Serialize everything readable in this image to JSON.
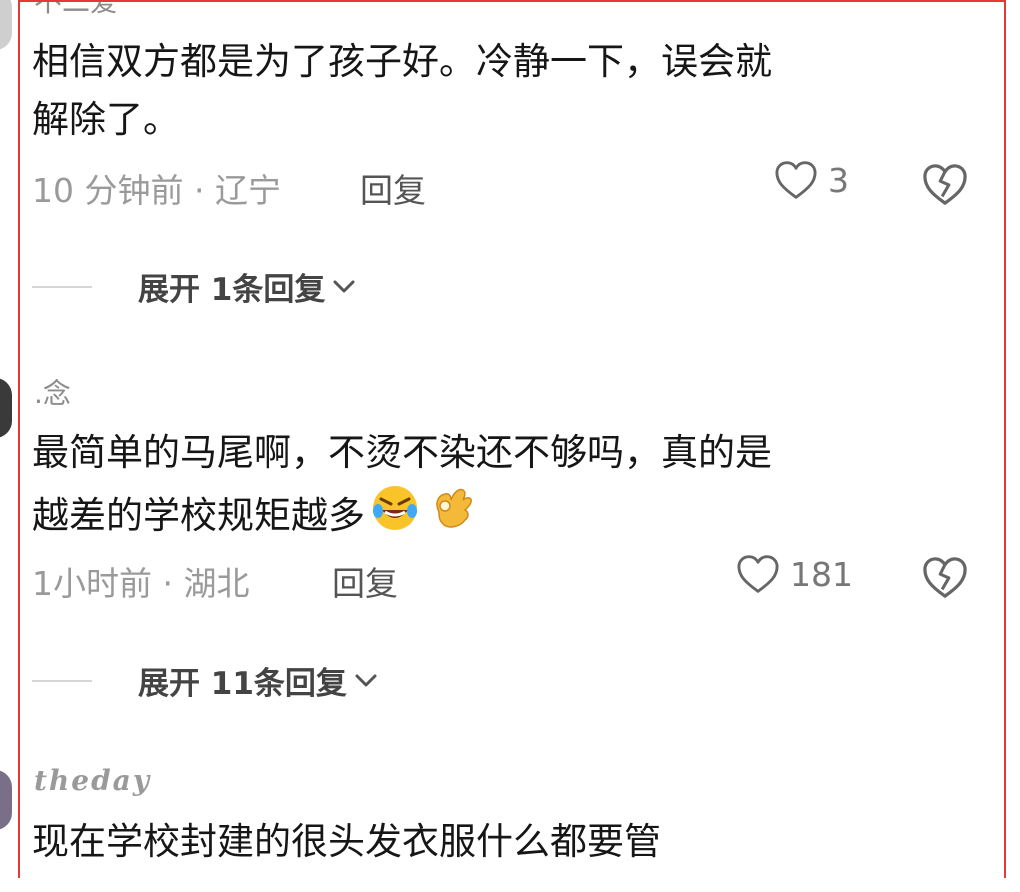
{
  "comments": [
    {
      "username": "不二爱",
      "content_line1": "相信双方都是为了孩子好。冷静一下，误会就",
      "content_line2": "解除了。",
      "meta": "10 分钟前 · 辽宁",
      "reply_label": "回复",
      "likes": "3",
      "expand_label": "展开 1条回复"
    },
    {
      "username": ".念",
      "content_line1": "最简单的马尾啊，不烫不染还不够吗，真的是",
      "content_line2": "越差的学校规矩越多",
      "meta": "1小时前 · 湖北",
      "reply_label": "回复",
      "likes": "181",
      "expand_label": "展开 11条回复"
    },
    {
      "username": "theday",
      "content_line1": "现在学校封建的很头发衣服什么都要管"
    }
  ],
  "icons": {
    "like": "heart-outline-icon",
    "dislike": "broken-heart-icon",
    "expand": "chevron-down-icon",
    "emoji1": "rofl-emoji",
    "emoji2": "ok-hand-emoji"
  },
  "colors": {
    "highlight_border": "#e53935"
  }
}
